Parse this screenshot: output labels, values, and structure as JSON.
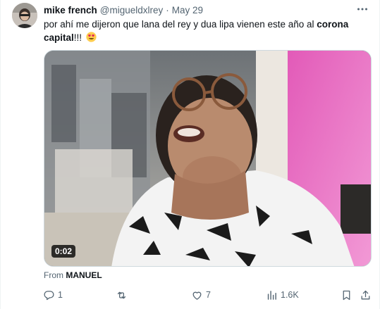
{
  "tweet": {
    "author_name": "mike french",
    "handle": "@migueldxlrey",
    "separator": "·",
    "date": "May 29",
    "text_main": "por ahí me dijeron que lana del rey y dua lipa vienen este año al ",
    "text_bold": "corona capital",
    "text_tail": "!!! ",
    "emoji": "heart-eyes-emoji",
    "media": {
      "duration": "0:02"
    },
    "from_prefix": "From ",
    "from_source": "MANUEL",
    "actions": {
      "replies": "1",
      "retweets": "",
      "likes": "7",
      "views": "1.6K"
    }
  },
  "icons": {
    "more": "more-dots-icon",
    "reply": "reply-icon",
    "retweet": "retweet-icon",
    "like": "heart-icon",
    "views": "views-chart-icon",
    "bookmark": "bookmark-icon",
    "share": "share-icon"
  },
  "colors": {
    "secondary_text": "#536471",
    "primary_text": "#0f1419",
    "border": "#cfd9de"
  }
}
